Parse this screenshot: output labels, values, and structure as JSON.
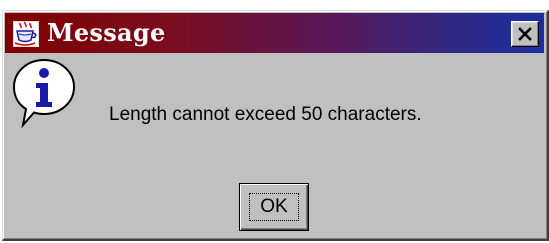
{
  "window": {
    "title": "Message",
    "title_icon": "coffee-cup-icon",
    "close_icon": "close-icon"
  },
  "message": {
    "icon": "info-icon",
    "text": "Length cannot exceed 50 characters."
  },
  "buttons": {
    "ok_label": "OK"
  },
  "colors": {
    "title_gradient_start": "#800000",
    "title_gradient_end": "#1b2da0",
    "dialog_background": "#c0c0c0",
    "info_icon_blue": "#1a1aa8"
  }
}
